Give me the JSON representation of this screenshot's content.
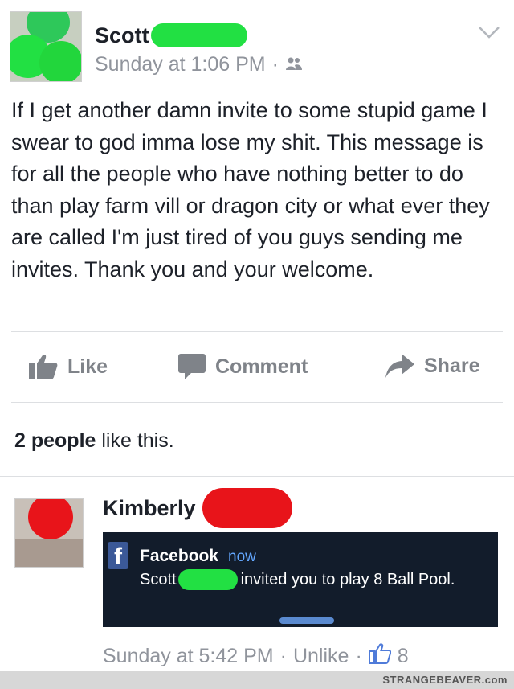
{
  "post": {
    "author": "Scott",
    "timestamp": "Sunday at 1:06 PM",
    "separator": "·",
    "audience_icon": "friends-icon",
    "text": "If I get another damn invite to some stupid game I swear to god imma lose my shit. This message is for all the people who have nothing better to do than play farm vill or dragon city or what ever they are called I'm just tired of you guys sending me invites. Thank you and your welcome."
  },
  "actions": {
    "like": "Like",
    "comment": "Comment",
    "share": "Share"
  },
  "likes": {
    "count_text": "2 people",
    "suffix": "like this."
  },
  "comment": {
    "author": "Kimberly",
    "notification": {
      "app": "Facebook",
      "time": "now",
      "sender": "Scott",
      "message": "invited you to play 8 Ball Pool."
    },
    "timestamp": "Sunday at 5:42 PM",
    "separator": "·",
    "unlike": "Unlike",
    "like_count": "8"
  },
  "watermark": "STRANGEBEAVER.com",
  "colors": {
    "redaction_green": "#22e043",
    "redaction_red": "#e8141a",
    "facebook_blue": "#3b5998",
    "muted_text": "#90949c"
  }
}
